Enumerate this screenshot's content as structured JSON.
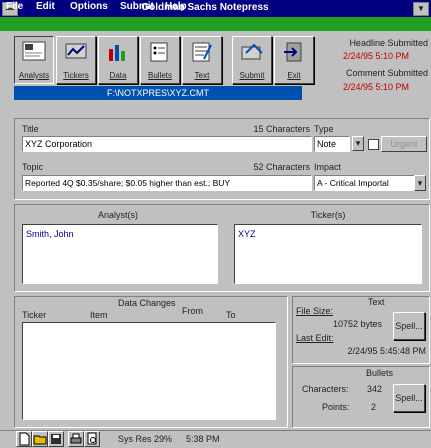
{
  "window": {
    "title": "Goldman Sachs Notepress"
  },
  "menu": [
    "File",
    "Edit",
    "Options",
    "Submit",
    "Help"
  ],
  "toolbar": [
    {
      "label": "Analysts",
      "icon": "analysts-icon"
    },
    {
      "label": "Tickers",
      "icon": "tickers-icon"
    },
    {
      "label": "Data",
      "icon": "data-icon"
    },
    {
      "label": "Bullets",
      "icon": "bullets-icon"
    },
    {
      "label": "Text",
      "icon": "text-icon"
    },
    {
      "label": "Submit",
      "icon": "submit-icon"
    },
    {
      "label": "Exit",
      "icon": "exit-icon"
    }
  ],
  "submission": {
    "headline_label": "Headline Submitted",
    "headline_time": "2/24/95 5:10 PM",
    "comment_label": "Comment Submitted",
    "comment_time": "2/24/95 5:10 PM"
  },
  "file_path": "F:\\NOTXPRES\\XYZ.CMT",
  "form": {
    "title_label": "Title",
    "title_count": "15 Characters",
    "title_value": "XYZ Corporation",
    "type_label": "Type",
    "type_value": "Note",
    "urgent_label": "Urgent",
    "topic_label": "Topic",
    "topic_count": "52 Characters",
    "topic_value": "Reported 4Q $0.35/share; $0.05 higher than est.; BUY",
    "impact_label": "Impact",
    "impact_value": "A - Critical Importal"
  },
  "analysts": {
    "label": "Analyst(s)",
    "items": [
      "Smith, John"
    ]
  },
  "tickers": {
    "label": "Ticker(s)",
    "items": [
      "XYZ"
    ]
  },
  "data_changes": {
    "label": "Data Changes",
    "columns": [
      "Ticker",
      "Item",
      "From",
      "To"
    ]
  },
  "text_panel": {
    "label": "Text",
    "file_size_label": "File Size:",
    "file_size_value": "10752 bytes",
    "last_edit_label": "Last Edit:",
    "last_edit_value": "2/24/95 5:45:48 PM",
    "spell_label": "Spell..."
  },
  "bullets_panel": {
    "label": "Bullets",
    "characters_label": "Characters:",
    "characters_value": "342",
    "points_label": "Points:",
    "points_value": "2",
    "spell_label": "Spell..."
  },
  "statusbar": {
    "sys_res": "Sys Res 29%",
    "time": "5:38 PM"
  }
}
